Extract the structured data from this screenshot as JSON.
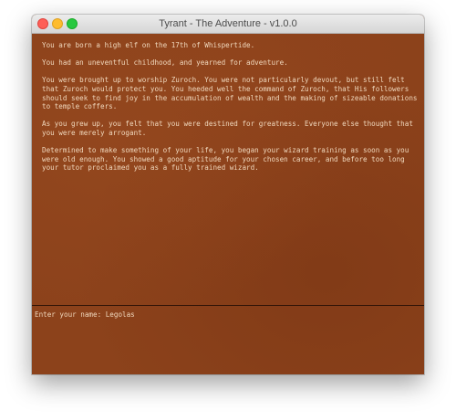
{
  "window": {
    "title": "Tyrant - The Adventure - v1.0.0"
  },
  "story": {
    "paragraphs": [
      "You are born a high elf on the 17th of Whispertide.",
      "You had an uneventful childhood, and yearned for adventure.",
      "You were brought up to worship Zuroch. You were not particularly devout, but still felt that Zuroch would protect you. You heeded well the command of Zuroch, that His followers should seek to find joy in the accumulation of wealth and the making of sizeable donations to temple coffers.",
      "As you grew up, you felt that you were destined for greatness. Everyone else thought that you were merely arrogant.",
      "Determined to make something of your life, you began your wizard training as soon as you were old enough. You showed a good aptitude for your chosen career, and before too long your tutor proclaimed you as a fully trained wizard."
    ]
  },
  "prompt": {
    "label": "Enter your name: ",
    "value": "Legolas"
  },
  "colors": {
    "background": "#8c421b",
    "text": "#f1d9be",
    "divider": "#2e1206"
  }
}
